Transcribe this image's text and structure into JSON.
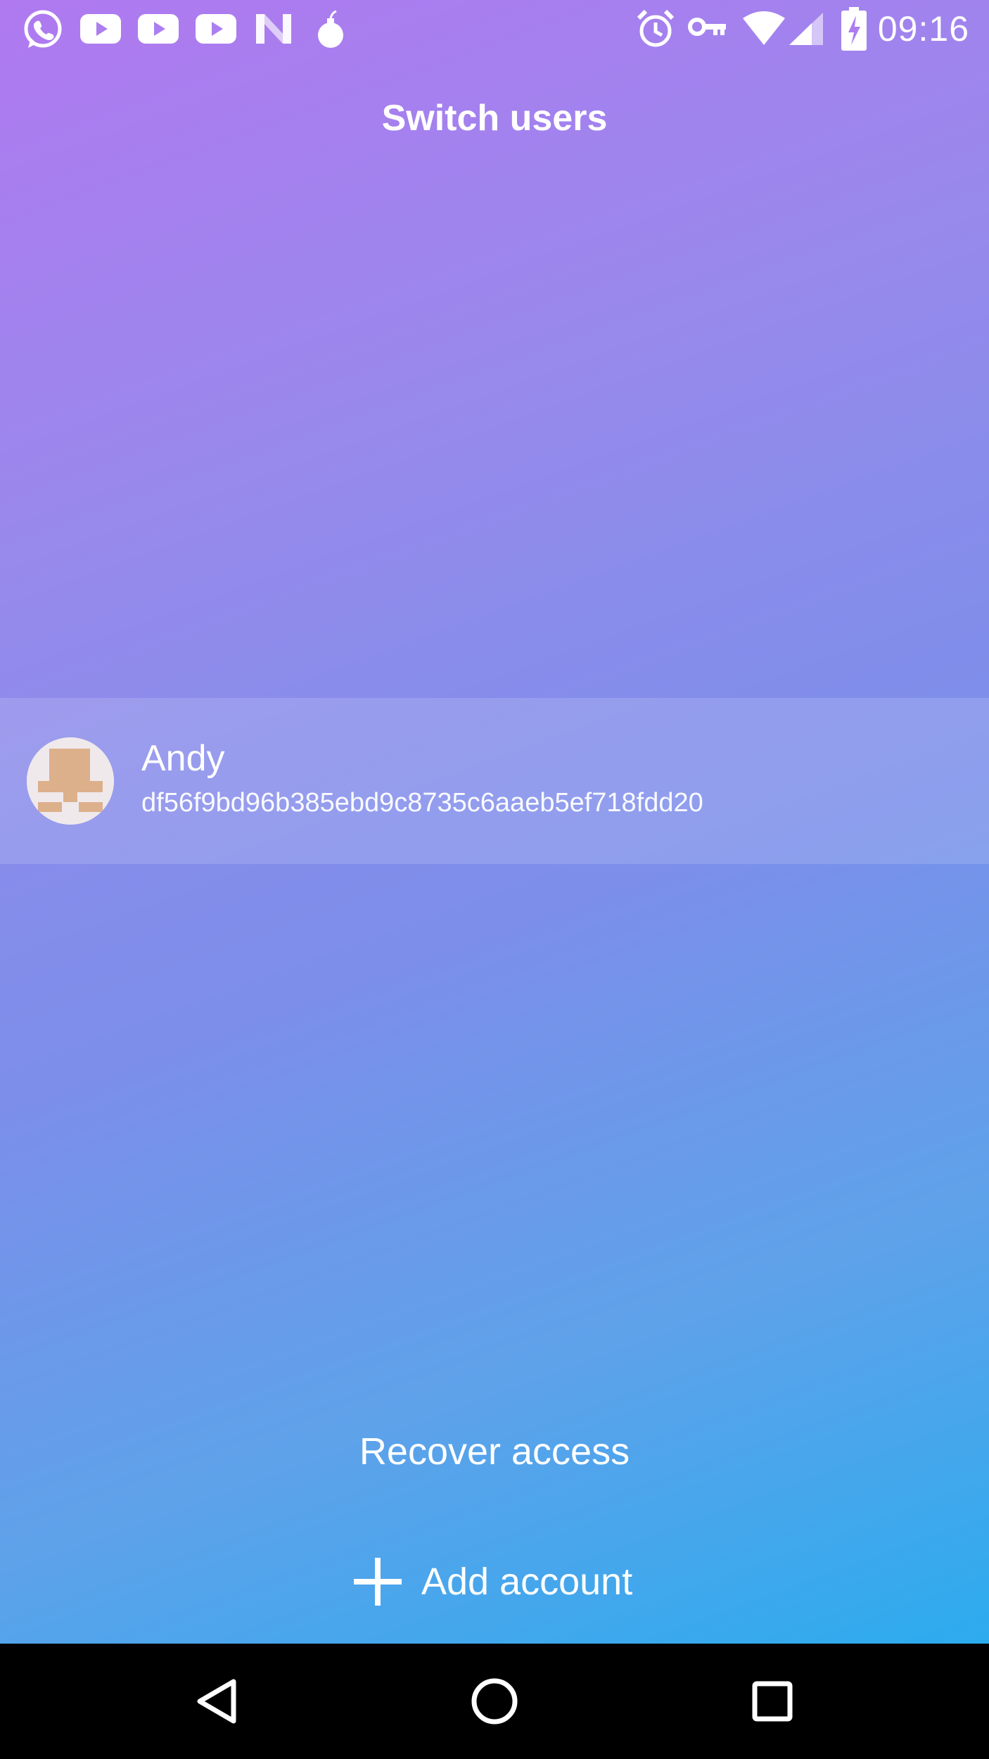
{
  "status_bar": {
    "time": "09:16",
    "left_icons": [
      "whatsapp-icon",
      "youtube-icon",
      "youtube-icon",
      "youtube-icon",
      "n-app-icon",
      "bomb-icon"
    ],
    "right_icons": [
      "alarm-icon",
      "vpn-key-icon",
      "wifi-icon",
      "cell-signal-icon",
      "battery-charging-icon"
    ]
  },
  "header": {
    "title": "Switch users"
  },
  "accounts": [
    {
      "name": "Andy",
      "id": "df56f9bd96b385ebd9c8735c6aaeb5ef718fdd20",
      "avatar": "identicon-avatar"
    }
  ],
  "actions": {
    "recover_label": "Recover access",
    "add_account_label": "Add account",
    "add_icon": "plus-icon"
  },
  "nav_bar": {
    "buttons": [
      "back-icon",
      "home-icon",
      "recents-icon"
    ]
  },
  "colors": {
    "gradient_top": "#b079f0",
    "gradient_middle": "#8a8ceb",
    "gradient_bottom": "#2dabee",
    "avatar_background": "#efe9ec",
    "avatar_pattern": "#ddb08c",
    "nav_bar": "#000000"
  }
}
